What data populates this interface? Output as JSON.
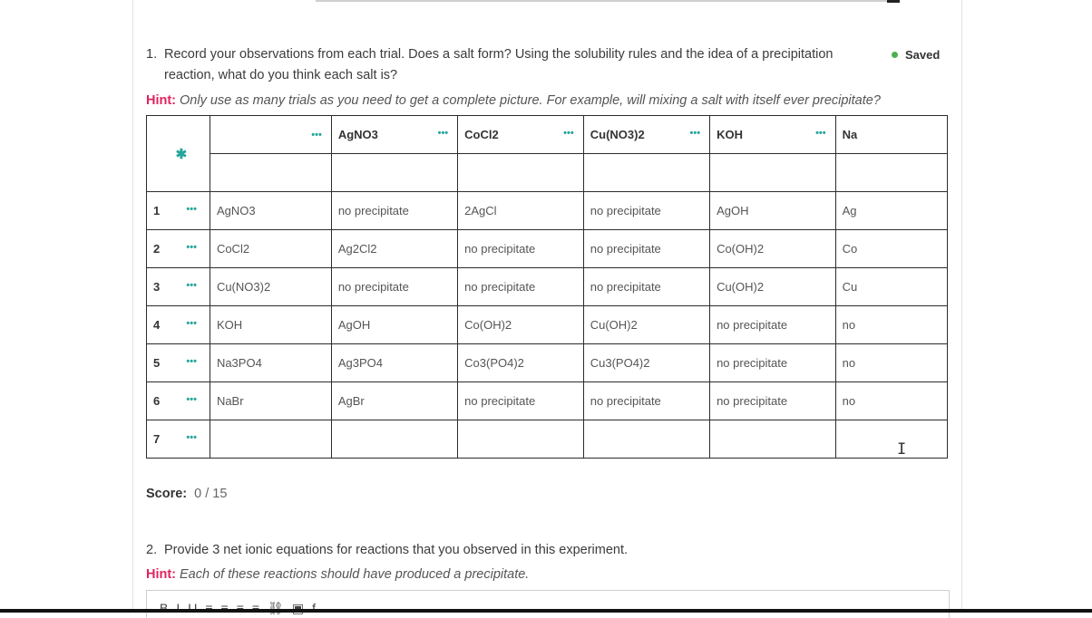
{
  "question1": {
    "number": "1.",
    "line1": "Record your observations from each trial. Does a salt form? Using the solubility rules and the idea of a precipitation",
    "line2": "reaction, what do you think each salt is?",
    "hint_label": "Hint:",
    "hint_text": "Only use as many trials as you need to get a complete picture. For example, will mixing a salt with itself ever precipitate?"
  },
  "status": {
    "saved": "Saved"
  },
  "table": {
    "headers": [
      "",
      "AgNO3",
      "CoCl2",
      "Cu(NO3)2",
      "KOH",
      "Na"
    ],
    "row_labels": [
      "1",
      "2",
      "3",
      "4",
      "5",
      "6",
      "7"
    ],
    "rows": [
      [
        "AgNO3",
        "no precipitate",
        "2AgCl",
        "no precipitate",
        "AgOH",
        "Ag"
      ],
      [
        "CoCl2",
        "Ag2Cl2",
        "no precipitate",
        "no precipitate",
        "Co(OH)2",
        "Co"
      ],
      [
        "Cu(NO3)2",
        "no precipitate",
        "no precipitate",
        "no precipitate",
        "Cu(OH)2",
        "Cu"
      ],
      [
        "KOH",
        "AgOH",
        "Co(OH)2",
        "Cu(OH)2",
        "no precipitate",
        "no"
      ],
      [
        "Na3PO4",
        "Ag3PO4",
        "Co3(PO4)2",
        "Cu3(PO4)2",
        "no precipitate",
        "no"
      ],
      [
        "NaBr",
        "AgBr",
        "no precipitate",
        "no precipitate",
        "no precipitate",
        "no"
      ],
      [
        "",
        "",
        "",
        "",
        "",
        ""
      ]
    ],
    "menu_glyph": "•••",
    "settings_icon": "gear-icon"
  },
  "score": {
    "label": "Score:",
    "value": "0 / 15"
  },
  "question2": {
    "number": "2.",
    "text": "Provide 3 net ionic equations for reactions that you observed in this experiment.",
    "hint_label": "Hint:",
    "hint_text": "Each of these reactions should have produced a precipitate."
  },
  "editor_toolbar": [
    "B",
    "I",
    "U",
    "≡",
    "≡",
    "≡",
    "≡",
    "⛓",
    "▣",
    "f"
  ],
  "colors": {
    "accent": "#26a69a",
    "hint": "#e0245e",
    "saved_dot": "#4caf50"
  }
}
